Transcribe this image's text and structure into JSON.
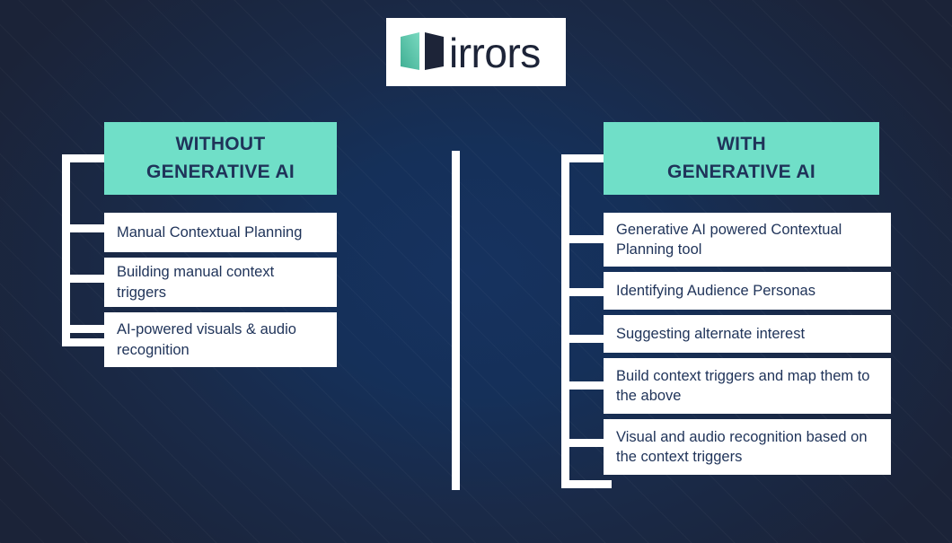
{
  "logo": {
    "wordmark": "irrors",
    "mark_name": "open-book-mirror-icon",
    "teal": "#4cb99c",
    "navy": "#1d2438"
  },
  "theme": {
    "background_dark": "#1b2338",
    "background_center": "#16325f",
    "accent_teal": "#70dfc8",
    "text_navy": "#1f3359",
    "card_bg": "#ffffff"
  },
  "columns": [
    {
      "id": "without",
      "header_line1": "WITHOUT",
      "header_line2": "GENERATIVE AI",
      "items": [
        {
          "text": "Manual Contextual Planning"
        },
        {
          "text": "Building manual context triggers"
        },
        {
          "text": "AI-powered visuals & audio recognition"
        }
      ]
    },
    {
      "id": "with",
      "header_line1": "WITH",
      "header_line2": "GENERATIVE AI",
      "items": [
        {
          "text": "Generative AI powered Contextual Planning tool"
        },
        {
          "text": "Identifying Audience Personas"
        },
        {
          "text": "Suggesting alternate interest"
        },
        {
          "text": "Build context triggers and map them to the above"
        },
        {
          "text": "Visual and audio recognition based on the context triggers"
        }
      ]
    }
  ]
}
